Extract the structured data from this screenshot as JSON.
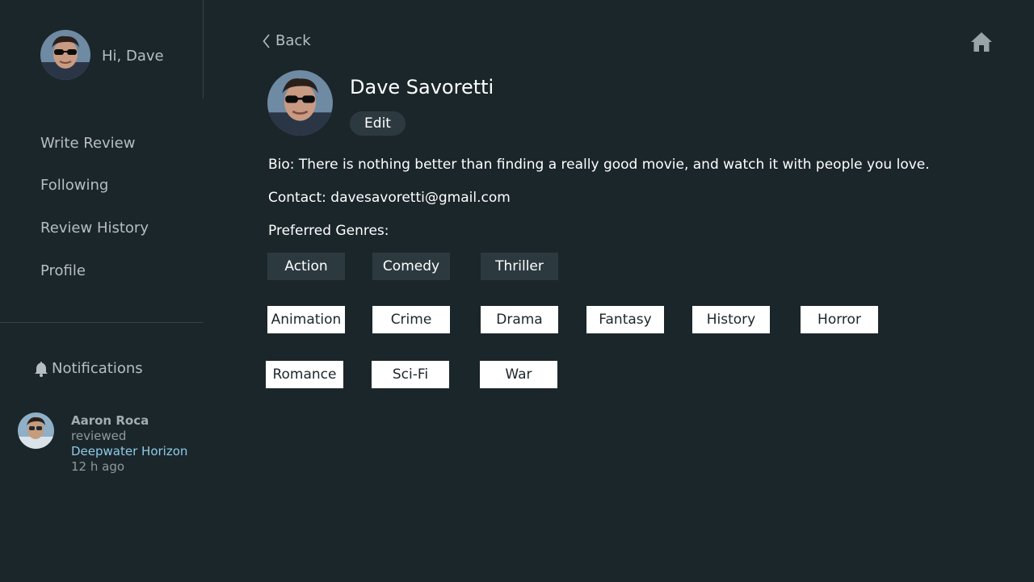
{
  "sidebar": {
    "greeting": "Hi, Dave",
    "nav": [
      {
        "label": "Write Review"
      },
      {
        "label": "Following"
      },
      {
        "label": "Review History"
      },
      {
        "label": "Profile"
      }
    ],
    "notifications": {
      "title": "Notifications",
      "items": [
        {
          "user": "Aaron Roca",
          "action": "reviewed",
          "movie": "Deepwater Horizon",
          "time": "12 h ago"
        }
      ]
    }
  },
  "main": {
    "back_label": "Back",
    "profile": {
      "name": "Dave Savoretti",
      "edit_label": "Edit",
      "bio": "Bio: There is nothing better than finding a really good movie, and watch it with people you love.",
      "contact": "Contact: davesavoretti@gmail.com",
      "genres_label": "Preferred Genres:"
    },
    "genres": [
      {
        "label": "Action",
        "selected": true
      },
      {
        "label": "Comedy",
        "selected": true
      },
      {
        "label": "Thriller",
        "selected": true
      },
      {
        "label": "Animation",
        "selected": false
      },
      {
        "label": "Crime",
        "selected": false
      },
      {
        "label": "Drama",
        "selected": false
      },
      {
        "label": "Fantasy",
        "selected": false
      },
      {
        "label": "History",
        "selected": false
      },
      {
        "label": "Horror",
        "selected": false
      },
      {
        "label": "Romance",
        "selected": false
      },
      {
        "label": "Sci-Fi",
        "selected": false
      },
      {
        "label": "War",
        "selected": false
      }
    ]
  },
  "colors": {
    "background": "#1b262b",
    "selected_chip": "#2c3a40",
    "link": "#8ecbe6"
  },
  "icons": [
    "chevron-left-icon",
    "home-icon",
    "bell-icon",
    "avatar"
  ]
}
